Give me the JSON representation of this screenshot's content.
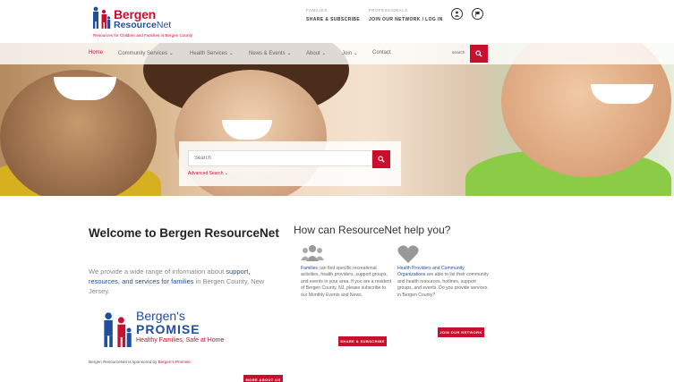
{
  "header": {
    "logo": {
      "brand_line1": "Bergen",
      "brand_line2_a": "Resource",
      "brand_line2_b": "Net",
      "tagline": "Resources for Children and Families in Bergen County"
    },
    "families": {
      "label": "FAMILIES",
      "link": "SHARE & SUBSCRIBE"
    },
    "professionals": {
      "label": "PROFESSIONALS",
      "link": "JOIN OUR NETWORK / LOG IN"
    },
    "icons": [
      "user-icon",
      "flag-icon"
    ]
  },
  "nav": {
    "items": [
      "Home",
      "Community Services",
      "Health Services",
      "News & Events",
      "About",
      "Join",
      "Contact"
    ],
    "search_label": "search"
  },
  "hero": {
    "search_placeholder": "Search",
    "advanced_search": "Advanced Search"
  },
  "welcome": {
    "title": "Welcome to Bergen ResourceNet",
    "intro_a": "We provide a wide range of information about ",
    "intro_link": "support, resources, and services for families",
    "intro_b": " in Bergen County, New Jersey.",
    "promise": {
      "line1": "Bergen's",
      "line2": "PROMISE",
      "line3": "Healthy Families, Safe at Home"
    },
    "sponsor_a": "Bergen ResourceNet is sponsored by ",
    "sponsor_link": "Bergen's Promise",
    "sponsor_b": ".",
    "more_button": "MORE ABOUT US"
  },
  "help": {
    "title": "How can ResourceNet help you?",
    "families": {
      "icon": "group-icon",
      "link": "Families",
      "text": " can find specific recreational activities, health providers, support groups, and events in your area. If you are a resident of Bergen County, NJ, please subscribe to our Monthly Events and News.",
      "button": "SHARE & SUBSCRIBE"
    },
    "providers": {
      "icon": "heart-icon",
      "link": "Health Providers and Community Organizations",
      "text": " are able to list their community and health resources, hotlines, support groups, and events. Do you provide services in Bergen County?",
      "button": "JOIN OUR NETWORK"
    }
  },
  "colors": {
    "brand_red": "#c8102e",
    "brand_blue": "#1f4e9e"
  }
}
